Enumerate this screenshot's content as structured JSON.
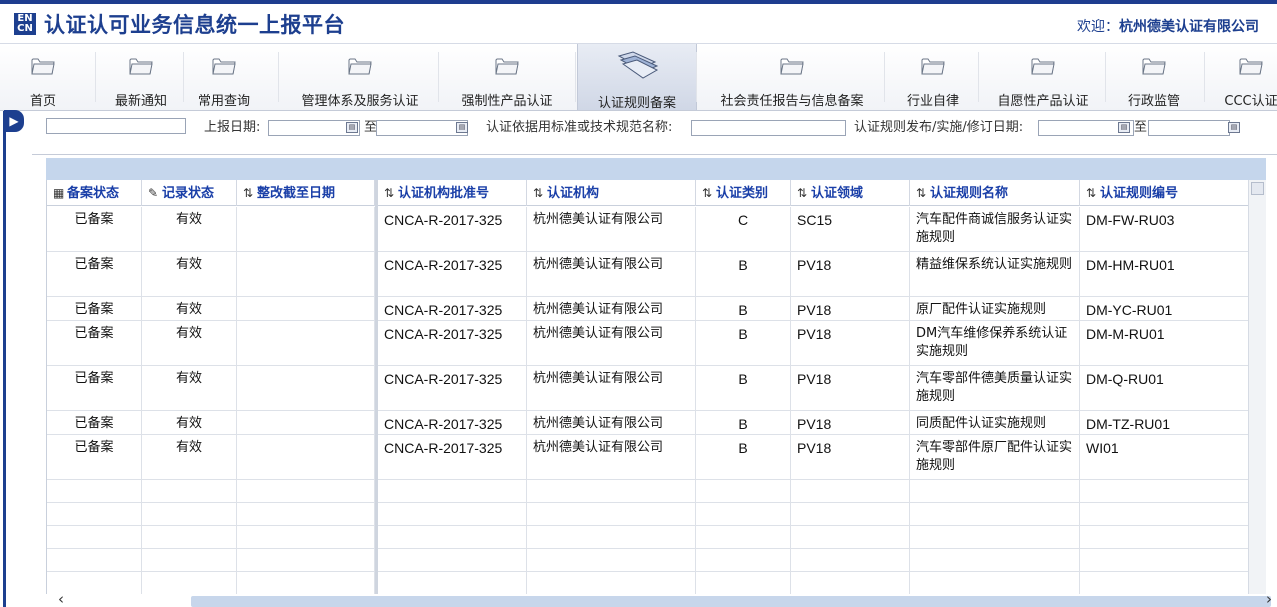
{
  "header": {
    "logo_text": "ENCN",
    "app_title": "认证认可业务信息统一上报平台",
    "welcome_prefix": "欢迎：",
    "welcome_org": "杭州德美认证有限公司"
  },
  "nav": {
    "items": [
      {
        "label": "首页"
      },
      {
        "label": "最新通知"
      },
      {
        "label": "常用查询"
      },
      {
        "label": "管理体系及服务认证"
      },
      {
        "label": "强制性产品认证"
      },
      {
        "label": "认证规则备案",
        "active": true
      },
      {
        "label": "社会责任报告与信息备案"
      },
      {
        "label": "行业自律"
      },
      {
        "label": "自愿性产品认证"
      },
      {
        "label": "行政监管"
      },
      {
        "label": "CCC认证"
      }
    ]
  },
  "filter": {
    "report_date_label": "上报日期:",
    "to_label": "至",
    "basis_label": "认证依据用标准或技术规范名称:",
    "rule_date_label": "认证规则发布/实施/修订日期:",
    "to_label_2": "至"
  },
  "table": {
    "columns": [
      "备案状态",
      "记录状态",
      "整改截至日期",
      "认证机构批准号",
      "认证机构",
      "认证类别",
      "认证领域",
      "认证规则名称",
      "认证规则编号"
    ],
    "rows": [
      {
        "filing_status": "已备案",
        "record_status": "有效",
        "deadline": "",
        "approval_no": "CNCA-R-2017-325",
        "org": "杭州德美认证有限公司",
        "category": "C",
        "field": "SC15",
        "rule_name": "汽车配件商诚信服务认证实施规则",
        "rule_no": "DM-FW-RU03"
      },
      {
        "filing_status": "已备案",
        "record_status": "有效",
        "deadline": "",
        "approval_no": "CNCA-R-2017-325",
        "org": "杭州德美认证有限公司",
        "category": "B",
        "field": "PV18",
        "rule_name": "精益维保系统认证实施规则",
        "rule_no": "DM-HM-RU01"
      },
      {
        "filing_status": "已备案",
        "record_status": "有效",
        "deadline": "",
        "approval_no": "CNCA-R-2017-325",
        "org": "杭州德美认证有限公司",
        "category": "B",
        "field": "PV18",
        "rule_name": "原厂配件认证实施规则",
        "rule_no": "DM-YC-RU01"
      },
      {
        "filing_status": "已备案",
        "record_status": "有效",
        "deadline": "",
        "approval_no": "CNCA-R-2017-325",
        "org": "杭州德美认证有限公司",
        "category": "B",
        "field": "PV18",
        "rule_name": "DM汽车维修保养系统认证实施规则",
        "rule_no": "DM-M-RU01"
      },
      {
        "filing_status": "已备案",
        "record_status": "有效",
        "deadline": "",
        "approval_no": "CNCA-R-2017-325",
        "org": "杭州德美认证有限公司",
        "category": "B",
        "field": "PV18",
        "rule_name": "汽车零部件德美质量认证实施规则",
        "rule_no": "DM-Q-RU01"
      },
      {
        "filing_status": "已备案",
        "record_status": "有效",
        "deadline": "",
        "approval_no": "CNCA-R-2017-325",
        "org": "杭州德美认证有限公司",
        "category": "B",
        "field": "PV18",
        "rule_name": "同质配件认证实施规则",
        "rule_no": "DM-TZ-RU01"
      },
      {
        "filing_status": "已备案",
        "record_status": "有效",
        "deadline": "",
        "approval_no": "CNCA-R-2017-325",
        "org": "杭州德美认证有限公司",
        "category": "B",
        "field": "PV18",
        "rule_name": "汽车零部件原厂配件认证实施规则",
        "rule_no": "WI01"
      }
    ]
  },
  "icons": {
    "collapse": "expand-right-icon",
    "calendar": "calendar-icon",
    "sort": "sort-icon",
    "folder": "folder-icon"
  },
  "colors": {
    "brand": "#1d3f8f",
    "header_link": "#1a3fa8",
    "grid_band": "#c5d6ec"
  }
}
